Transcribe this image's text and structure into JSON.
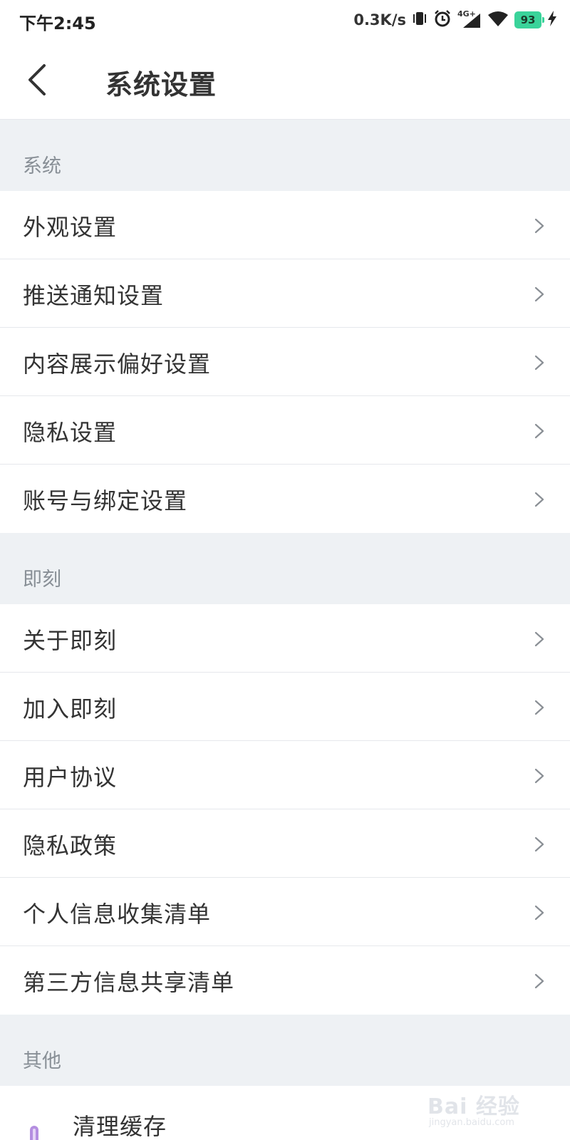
{
  "status_bar": {
    "time": "下午2:45",
    "net_speed": "0.3K/s",
    "network_type": "4G+",
    "battery": "93",
    "icons": [
      "vibrate-icon",
      "alarm-icon",
      "cellular-signal-icon",
      "wifi-icon",
      "battery-icon",
      "charging-icon"
    ]
  },
  "header": {
    "title": "系统设置",
    "back_icon": "chevron-left-icon"
  },
  "sections": [
    {
      "label": "系统",
      "items": [
        {
          "label": "外观设置"
        },
        {
          "label": "推送通知设置"
        },
        {
          "label": "内容展示偏好设置"
        },
        {
          "label": "隐私设置"
        },
        {
          "label": "账号与绑定设置"
        }
      ]
    },
    {
      "label": "即刻",
      "items": [
        {
          "label": "关于即刻"
        },
        {
          "label": "加入即刻"
        },
        {
          "label": "用户协议"
        },
        {
          "label": "隐私政策"
        },
        {
          "label": "个人信息收集清单"
        },
        {
          "label": "第三方信息共享清单"
        }
      ]
    },
    {
      "label": "其他",
      "items": [
        {
          "label": "清理缓存"
        }
      ]
    }
  ],
  "watermark": {
    "main": "Bai 经验",
    "sub": "jingyan.baidu.com"
  },
  "colors": {
    "section_bg": "#eef1f4",
    "divider": "#e6e8ec",
    "battery": "#3ad39a"
  }
}
